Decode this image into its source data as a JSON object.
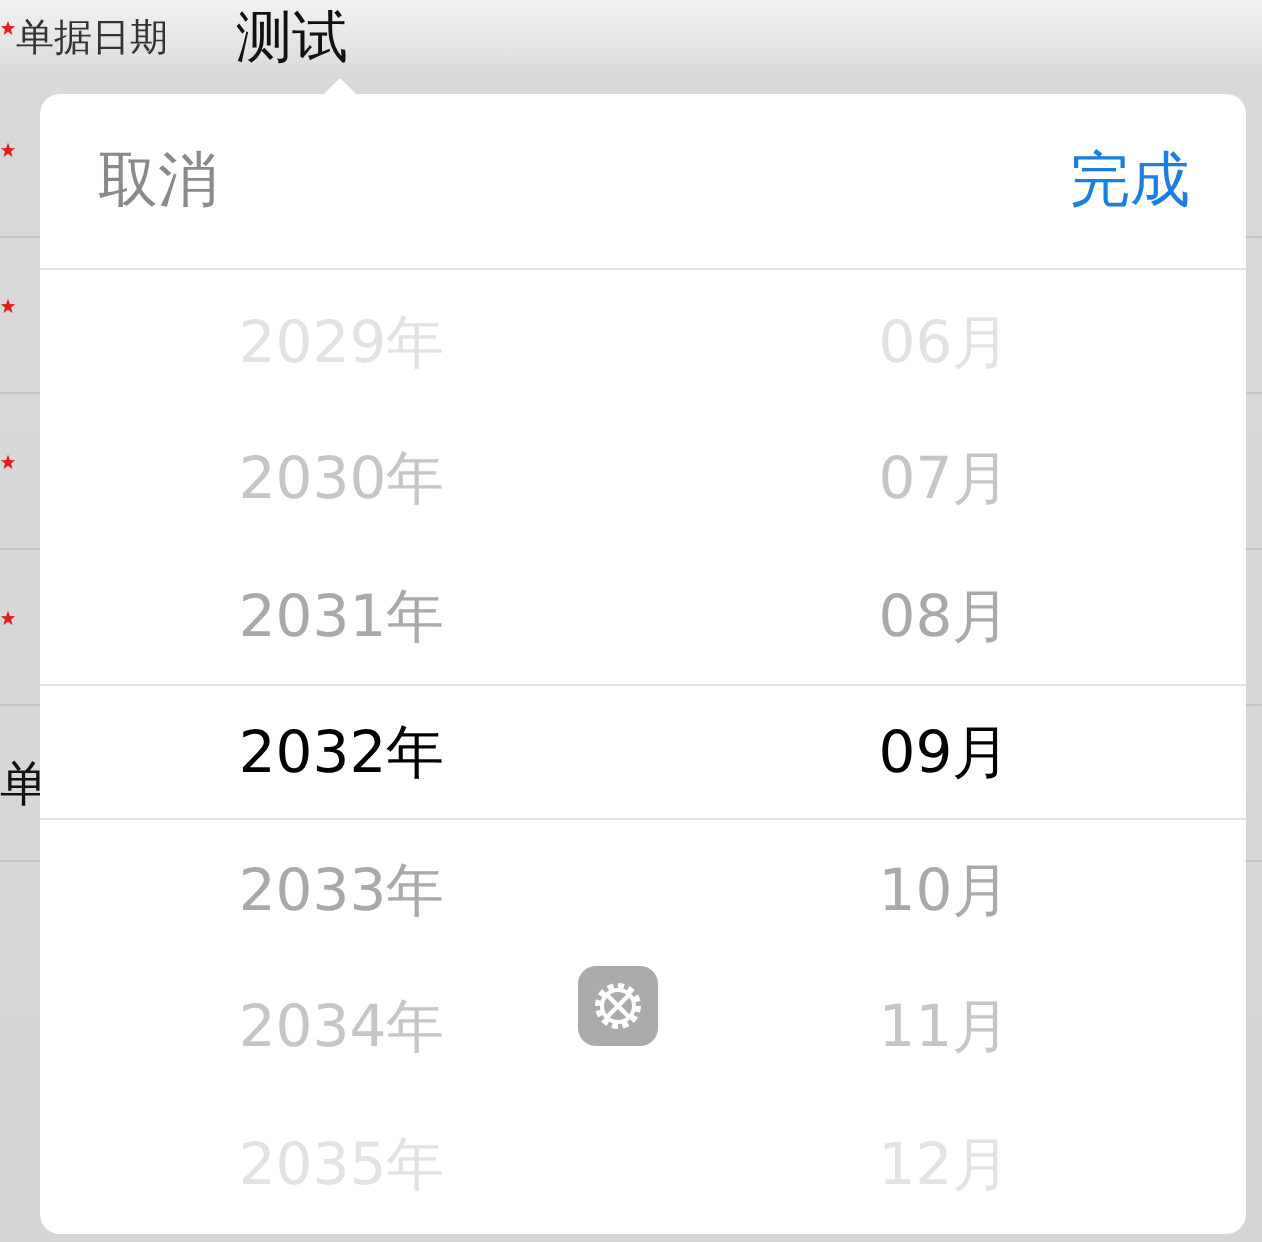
{
  "form": {
    "rows": [
      {
        "required": true,
        "label": "单据日期",
        "value": "测试"
      },
      {
        "required": true
      },
      {
        "required": true
      },
      {
        "required": true
      },
      {
        "required": true
      },
      {
        "required": false,
        "label": "单"
      }
    ]
  },
  "picker": {
    "cancel": "取消",
    "done": "完成",
    "columns": [
      {
        "items": [
          {
            "label": "2029年",
            "selected": false
          },
          {
            "label": "2030年",
            "selected": false
          },
          {
            "label": "2031年",
            "selected": false
          },
          {
            "label": "2032年",
            "selected": true
          },
          {
            "label": "2033年",
            "selected": false
          },
          {
            "label": "2034年",
            "selected": false
          },
          {
            "label": "2035年",
            "selected": false
          }
        ]
      },
      {
        "items": [
          {
            "label": "06月",
            "selected": false
          },
          {
            "label": "07月",
            "selected": false
          },
          {
            "label": "08月",
            "selected": false
          },
          {
            "label": "09月",
            "selected": true
          },
          {
            "label": "10月",
            "selected": false
          },
          {
            "label": "11月",
            "selected": false
          },
          {
            "label": "12月",
            "selected": false
          }
        ]
      }
    ]
  }
}
